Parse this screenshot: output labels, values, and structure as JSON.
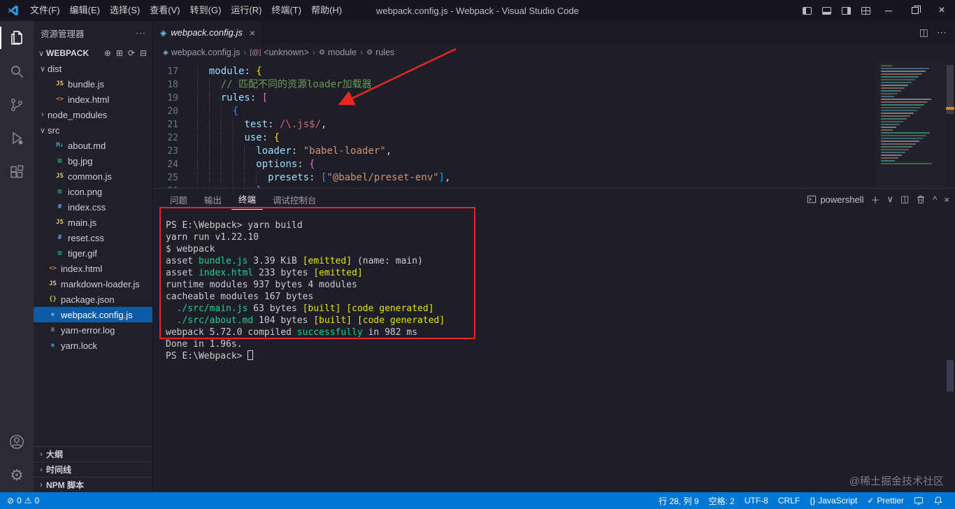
{
  "title_bar": {
    "title": "webpack.config.js - Webpack - Visual Studio Code",
    "menus": [
      "文件(F)",
      "编辑(E)",
      "选择(S)",
      "查看(V)",
      "转到(G)",
      "运行(R)",
      "终端(T)",
      "帮助(H)"
    ]
  },
  "sidebar": {
    "title": "资源管理器",
    "section": "WEBPACK",
    "tree": [
      {
        "label": "dist",
        "type": "folder",
        "expanded": true,
        "depth": 0
      },
      {
        "label": "bundle.js",
        "icon": "js-icon",
        "depth": 1
      },
      {
        "label": "index.html",
        "icon": "html-icon",
        "depth": 1
      },
      {
        "label": "node_modules",
        "type": "folder",
        "expanded": false,
        "depth": 0
      },
      {
        "label": "src",
        "type": "folder",
        "expanded": true,
        "depth": 0
      },
      {
        "label": "about.md",
        "icon": "markdown-icon",
        "depth": 1
      },
      {
        "label": "bg.jpg",
        "icon": "image-icon",
        "depth": 1
      },
      {
        "label": "common.js",
        "icon": "js-icon",
        "depth": 1
      },
      {
        "label": "icon.png",
        "icon": "image-icon",
        "depth": 1
      },
      {
        "label": "index.css",
        "icon": "css-icon",
        "depth": 1
      },
      {
        "label": "main.js",
        "icon": "js-icon",
        "depth": 1
      },
      {
        "label": "reset.css",
        "icon": "css-icon",
        "depth": 1
      },
      {
        "label": "tiger.gif",
        "icon": "image-icon",
        "depth": 1
      },
      {
        "label": "index.html",
        "icon": "html-icon",
        "depth": 0
      },
      {
        "label": "markdown-loader.js",
        "icon": "js-icon",
        "depth": 0
      },
      {
        "label": "package.json",
        "icon": "json-icon",
        "depth": 0
      },
      {
        "label": "webpack.config.js",
        "icon": "webpack-icon",
        "depth": 0,
        "selected": true
      },
      {
        "label": "yarn-error.log",
        "icon": "log-icon",
        "depth": 0
      },
      {
        "label": "yarn.lock",
        "icon": "yarn-icon",
        "depth": 0
      }
    ],
    "bottom_sections": [
      "大纲",
      "时间线",
      "NPM 脚本"
    ]
  },
  "editor": {
    "tab": {
      "label": "webpack.config.js"
    },
    "breadcrumb": [
      {
        "label": "webpack.config.js",
        "icon": "webpack-icon"
      },
      {
        "label": "<unknown>",
        "icon": "symbol-array-icon"
      },
      {
        "label": "module",
        "icon": "symbol-property-icon"
      },
      {
        "label": "rules",
        "icon": "symbol-property-icon"
      }
    ],
    "code_lines": [
      {
        "n": 17,
        "ind": 2,
        "tok": [
          [
            "k",
            "module"
          ],
          [
            "p",
            ": "
          ],
          [
            "b1",
            "{"
          ]
        ]
      },
      {
        "n": 18,
        "ind": 4,
        "tok": [
          [
            "c",
            "// 匹配不同的资源loader加载器"
          ]
        ]
      },
      {
        "n": 19,
        "ind": 4,
        "tok": [
          [
            "k",
            "rules"
          ],
          [
            "p",
            ": "
          ],
          [
            "b2",
            "["
          ]
        ]
      },
      {
        "n": 20,
        "ind": 6,
        "tok": [
          [
            "b3",
            "{"
          ]
        ]
      },
      {
        "n": 21,
        "ind": 8,
        "tok": [
          [
            "k",
            "test"
          ],
          [
            "p",
            ": "
          ],
          [
            "r",
            "/\\.js$/"
          ],
          [
            "p",
            ","
          ]
        ]
      },
      {
        "n": 22,
        "ind": 8,
        "tok": [
          [
            "k",
            "use"
          ],
          [
            "p",
            ": "
          ],
          [
            "b1",
            "{"
          ]
        ]
      },
      {
        "n": 23,
        "ind": 10,
        "tok": [
          [
            "k",
            "loader"
          ],
          [
            "p",
            ": "
          ],
          [
            "s",
            "\"babel-loader\""
          ],
          [
            "p",
            ","
          ]
        ]
      },
      {
        "n": 24,
        "ind": 10,
        "tok": [
          [
            "k",
            "options"
          ],
          [
            "p",
            ": "
          ],
          [
            "b2",
            "{"
          ]
        ]
      },
      {
        "n": 25,
        "ind": 12,
        "tok": [
          [
            "k",
            "presets"
          ],
          [
            "p",
            ": "
          ],
          [
            "b3",
            "["
          ],
          [
            "s",
            "\"@babel/preset-env\""
          ],
          [
            "b3",
            "]"
          ],
          [
            "p",
            ","
          ]
        ]
      },
      {
        "n": 26,
        "ind": 10,
        "tok": [
          [
            "b2",
            "}"
          ]
        ]
      }
    ]
  },
  "panel": {
    "tabs": [
      {
        "label": "问题",
        "active": false
      },
      {
        "label": "输出",
        "active": false
      },
      {
        "label": "终端",
        "active": true
      },
      {
        "label": "调试控制台",
        "active": false
      }
    ],
    "shell_label": "powershell",
    "terminal_lines": [
      [
        [
          "d",
          "PS E:\\Webpack> yarn build"
        ]
      ],
      [
        [
          "d",
          "yarn run v1.22.10"
        ]
      ],
      [
        [
          "d",
          "$ webpack"
        ]
      ],
      [
        [
          "d",
          "asset "
        ],
        [
          "g",
          "bundle.js"
        ],
        [
          "d",
          " 3.39 KiB "
        ],
        [
          "y",
          "[emitted]"
        ],
        [
          "d",
          " (name: main)"
        ]
      ],
      [
        [
          "d",
          "asset "
        ],
        [
          "g",
          "index.html"
        ],
        [
          "d",
          " 233 bytes "
        ],
        [
          "y",
          "[emitted]"
        ]
      ],
      [
        [
          "d",
          "runtime modules 937 bytes 4 modules"
        ]
      ],
      [
        [
          "d",
          "cacheable modules 167 bytes"
        ]
      ],
      [
        [
          "d",
          "  "
        ],
        [
          "g",
          "./src/main.js"
        ],
        [
          "d",
          " 63 bytes "
        ],
        [
          "y",
          "[built]"
        ],
        [
          "d",
          " "
        ],
        [
          "y",
          "[code generated]"
        ]
      ],
      [
        [
          "d",
          "  "
        ],
        [
          "g",
          "./src/about.md"
        ],
        [
          "d",
          " 104 bytes "
        ],
        [
          "y",
          "[built]"
        ],
        [
          "d",
          " "
        ],
        [
          "y",
          "[code generated]"
        ]
      ],
      [
        [
          "d",
          "webpack 5.72.0 compiled "
        ],
        [
          "g",
          "successfully"
        ],
        [
          "d",
          " in 982 ms"
        ]
      ],
      [
        [
          "d",
          "Done in 1.96s."
        ]
      ],
      [
        [
          "d",
          "PS E:\\Webpack> "
        ],
        [
          "cursor",
          ""
        ]
      ]
    ]
  },
  "status_bar": {
    "errors": "0",
    "warnings": "0",
    "cursor": "行 28, 列 9",
    "indent": "空格: 2",
    "encoding": "UTF-8",
    "eol": "CRLF",
    "language": "JavaScript",
    "language_icon": "{}",
    "formatter": "Prettier"
  },
  "watermark": "@稀土掘金技术社区"
}
